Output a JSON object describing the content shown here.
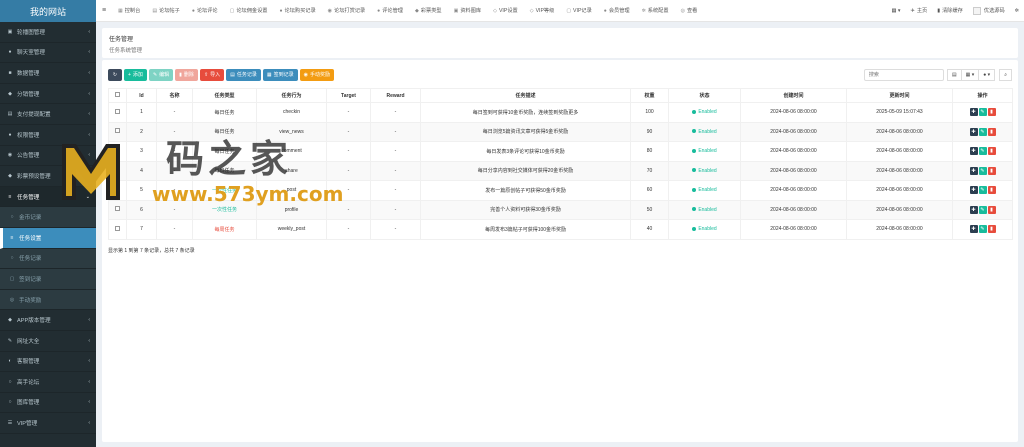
{
  "brand": {
    "title": "我的网站"
  },
  "sidebar": {
    "items": [
      {
        "label": "轮播图管理",
        "icon": "image-icon",
        "glyph": "▣",
        "kind": "top",
        "chevron": "‹"
      },
      {
        "label": "聊天室管理",
        "icon": "chat-icon",
        "glyph": "●",
        "kind": "top",
        "chevron": "‹"
      },
      {
        "label": "数据管理",
        "icon": "data-icon",
        "glyph": "■",
        "kind": "top",
        "chevron": "‹"
      },
      {
        "label": "分销管理",
        "icon": "share-icon",
        "glyph": "◆",
        "kind": "top",
        "chevron": "‹"
      },
      {
        "label": "支付提现配置",
        "icon": "pay-icon",
        "glyph": "▤",
        "kind": "top",
        "chevron": "‹"
      },
      {
        "label": "权限管理",
        "icon": "users-icon",
        "glyph": "●",
        "kind": "top",
        "chevron": "‹"
      },
      {
        "label": "公告管理",
        "icon": "notice-icon",
        "glyph": "◉",
        "kind": "top",
        "chevron": "‹"
      },
      {
        "label": "彩票预设管理",
        "icon": "lottery-icon",
        "glyph": "◆",
        "kind": "top",
        "chevron": "‹"
      },
      {
        "label": "任务管理",
        "icon": "task-icon",
        "glyph": "≡",
        "kind": "open",
        "chevron": "⌄"
      },
      {
        "label": "金币记录",
        "icon": "coin-icon",
        "glyph": "○",
        "kind": "sub",
        "chevron": ""
      },
      {
        "label": "任务设置",
        "icon": "list-icon",
        "glyph": "≡",
        "kind": "active",
        "chevron": ""
      },
      {
        "label": "任务记录",
        "icon": "record-icon",
        "glyph": "○",
        "kind": "sub",
        "chevron": ""
      },
      {
        "label": "签到记录",
        "icon": "sign-icon",
        "glyph": "▢",
        "kind": "sub",
        "chevron": ""
      },
      {
        "label": "手动奖励",
        "icon": "gift-icon",
        "glyph": "◎",
        "kind": "sub",
        "chevron": ""
      },
      {
        "label": "APP版本管理",
        "icon": "app-icon",
        "glyph": "◆",
        "kind": "top",
        "chevron": "‹"
      },
      {
        "label": "网址大全",
        "icon": "link-icon",
        "glyph": "✎",
        "kind": "top",
        "chevron": "‹"
      },
      {
        "label": "客服管理",
        "icon": "headset-icon",
        "glyph": "◐",
        "kind": "top",
        "chevron": "‹"
      },
      {
        "label": "高手论坛",
        "icon": "forum-icon",
        "glyph": "○",
        "kind": "top",
        "chevron": "‹"
      },
      {
        "label": "图库管理",
        "icon": "gallery-icon",
        "glyph": "○",
        "kind": "top",
        "chevron": "‹"
      },
      {
        "label": "VIP管理",
        "icon": "vip-icon",
        "glyph": "☰",
        "kind": "top",
        "chevron": "‹"
      }
    ]
  },
  "topbar": {
    "toggle": "≡",
    "tabs": [
      {
        "label": "控制台",
        "icon": "dashboard-icon",
        "glyph": "▦"
      },
      {
        "label": "论坛帖子",
        "icon": "post-icon",
        "glyph": "▤"
      },
      {
        "label": "论坛评论",
        "icon": "comment-icon",
        "glyph": "●"
      },
      {
        "label": "论坛佣金设置",
        "icon": "commission-icon",
        "glyph": "▢"
      },
      {
        "label": "论坛购买记录",
        "icon": "buy-icon",
        "glyph": "●"
      },
      {
        "label": "论坛打赏记录",
        "icon": "reward-icon",
        "glyph": "◉"
      },
      {
        "label": "评论管理",
        "icon": "review-icon",
        "glyph": "●"
      },
      {
        "label": "彩票类型",
        "icon": "lottery-type-icon",
        "glyph": "◆"
      },
      {
        "label": "资料图库",
        "icon": "album-icon",
        "glyph": "▣"
      },
      {
        "label": "VIP设置",
        "icon": "diamond-icon",
        "glyph": "◇"
      },
      {
        "label": "VIP等级",
        "icon": "level-icon",
        "glyph": "◇"
      },
      {
        "label": "VIP记录",
        "icon": "vip-record-icon",
        "glyph": "▢"
      },
      {
        "label": "会员管理",
        "icon": "member-icon",
        "glyph": "●"
      },
      {
        "label": "系统配置",
        "icon": "cog-icon",
        "glyph": "✲"
      },
      {
        "label": "查看",
        "icon": "view-icon",
        "glyph": "◎"
      }
    ],
    "right": {
      "menu_glyph": "▦ ▾",
      "home": "主页",
      "home_glyph": "✈",
      "clear_cache": "清除缓存",
      "clear_glyph": "▮",
      "username": "优选源码",
      "settings_glyph": "✲"
    }
  },
  "page": {
    "title": "任务管理",
    "subtitle": "任务系统管理"
  },
  "toolbar": {
    "refresh_glyph": "↻",
    "add": "添加",
    "add_glyph": "+",
    "edit": "编辑",
    "edit_glyph": "✎",
    "delete": "删除",
    "delete_glyph": "▮",
    "import": "导入",
    "import_glyph": "⇪",
    "task_record": "任务记录",
    "task_record_glyph": "▤",
    "sign_record": "签到记录",
    "sign_record_glyph": "▦",
    "manual_reward": "手动奖励",
    "manual_reward_glyph": "◉",
    "search_placeholder": "搜索",
    "view_glyph": "▤",
    "columns_glyph": "▦ ▾",
    "export_glyph": "● ▾",
    "search_glyph": "⌕"
  },
  "table": {
    "headers": [
      "",
      "Id",
      "名称",
      "任务类型",
      "任务行为",
      "Target",
      "Reward",
      "任务描述",
      "权重",
      "状态",
      "创建时间",
      "更新时间",
      "操作"
    ],
    "rows": [
      {
        "id": "1",
        "name": "-",
        "type": "每日任务",
        "type_class": "daily",
        "action": "checkin",
        "target": "-",
        "reward": "-",
        "desc": "每日签到可获得10金币奖励，连续签到奖励更多",
        "weight": "100",
        "status": "Enabled",
        "created": "2024-08-06 08:00:00",
        "updated": "2025-05-09 15:07:43"
      },
      {
        "id": "2",
        "name": "-",
        "type": "每日任务",
        "type_class": "daily",
        "action": "view_news",
        "target": "-",
        "reward": "-",
        "desc": "每日浏览5篇资讯文章可获得5金币奖励",
        "weight": "90",
        "status": "Enabled",
        "created": "2024-08-06 08:00:00",
        "updated": "2024-08-06 08:00:00"
      },
      {
        "id": "3",
        "name": "-",
        "type": "每日任务",
        "type_class": "daily",
        "action": "comment",
        "target": "-",
        "reward": "-",
        "desc": "每日发表3条评论可获得10金币奖励",
        "weight": "80",
        "status": "Enabled",
        "created": "2024-08-06 08:00:00",
        "updated": "2024-08-06 08:00:00"
      },
      {
        "id": "4",
        "name": "-",
        "type": "每日任务",
        "type_class": "daily",
        "action": "share",
        "target": "-",
        "reward": "-",
        "desc": "每日分享内容到社交媒体可获得20金币奖励",
        "weight": "70",
        "status": "Enabled",
        "created": "2024-08-06 08:00:00",
        "updated": "2024-08-06 08:00:00"
      },
      {
        "id": "5",
        "name": "-",
        "type": "一次性任务",
        "type_class": "once",
        "action": "post",
        "target": "-",
        "reward": "-",
        "desc": "发布一篇原创帖子可获得50金币奖励",
        "weight": "60",
        "status": "Enabled",
        "created": "2024-08-06 08:00:00",
        "updated": "2024-08-06 08:00:00"
      },
      {
        "id": "6",
        "name": "-",
        "type": "一次性任务",
        "type_class": "once",
        "action": "profile",
        "target": "-",
        "reward": "-",
        "desc": "完善个人资料可获得30金币奖励",
        "weight": "50",
        "status": "Enabled",
        "created": "2024-08-06 08:00:00",
        "updated": "2024-08-06 08:00:00"
      },
      {
        "id": "7",
        "name": "-",
        "type": "每周任务",
        "type_class": "weekly",
        "action": "weekly_post",
        "target": "-",
        "reward": "-",
        "desc": "每周发布3篇帖子可获得100金币奖励",
        "weight": "40",
        "status": "Enabled",
        "created": "2024-08-06 08:00:00",
        "updated": "2024-08-06 08:00:00"
      }
    ],
    "ops": {
      "drag": "✚",
      "edit": "✎",
      "delete": "▮"
    }
  },
  "pager": {
    "info": "显示第 1 到第 7 条记录，总共 7 条记录"
  },
  "watermark": {
    "text": "码之家",
    "url": "www.573ym.com",
    "logo": "M"
  },
  "colors": {
    "sidebar": "#222d32",
    "brand": "#367fa9",
    "active": "#3c8dbc",
    "success": "#18bc9c",
    "danger": "#e74c3c",
    "warning": "#f39c12"
  }
}
